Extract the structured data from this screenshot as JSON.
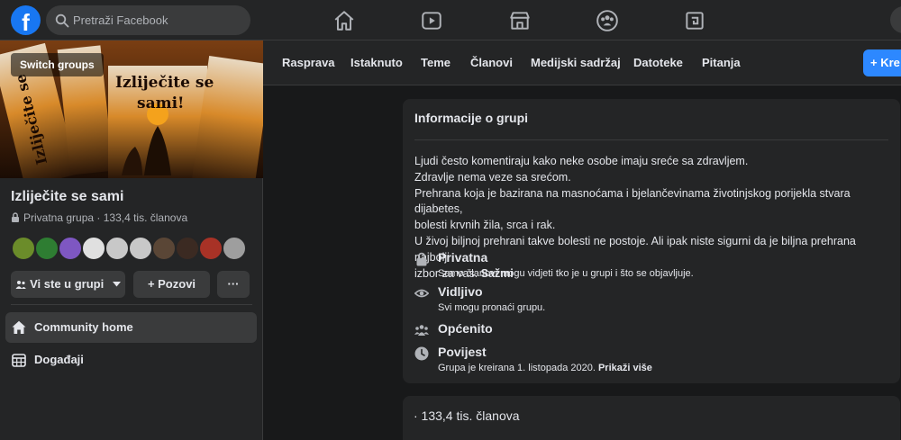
{
  "topbar": {
    "logo_letter": "f",
    "search_placeholder": "Pretraži Facebook",
    "nav_icons": [
      "home-icon",
      "watch-icon",
      "marketplace-icon",
      "groups-icon",
      "gaming-icon"
    ]
  },
  "sidebar": {
    "cover": {
      "switch_groups_label": "Switch groups",
      "poster_title_line1": "Izliječite se",
      "poster_title_line2": "sami!"
    },
    "group_name": "Izliječite se sami",
    "group_privacy": "Privatna grupa",
    "group_members": "· 133,4 tis. članova",
    "in_group_label": "Vi ste u grupi",
    "invite_label": "+ Pozovi",
    "more_label": "···",
    "menu": [
      {
        "label": "Community home",
        "icon": "home-icon",
        "active": true
      },
      {
        "label": "Događaji",
        "icon": "calendar-icon",
        "active": false
      }
    ]
  },
  "tabs": [
    "Rasprava",
    "Istaknuto",
    "Teme",
    "Članovi",
    "Medijski sadržaj",
    "Datoteke",
    "Pitanja"
  ],
  "create_button_label": "+ Kre",
  "about": {
    "title": "Informacije o grupi",
    "description_lines": [
      "Ljudi često komentiraju kako neke osobe imaju sreće sa zdravljem.",
      "Zdravlje nema veze sa srećom.",
      "Prehrana koja je bazirana na masnoćama i bjelančevinama životinjskog porijekla stvara dijabetes,",
      "bolesti krvnih žila, srca i rak.",
      "U živoj biljnoj prehrani takve bolesti ne postoje. Ali ipak niste sigurni da je biljna prehrana najbolji",
      "izbor za vas."
    ],
    "see_less": "Sažmi",
    "rows": [
      {
        "icon": "lock-icon",
        "title": "Privatna",
        "subtitle": "Samo članovi mogu vidjeti tko je u grupi i što se objavljuje.",
        "link": ""
      },
      {
        "icon": "eye-icon",
        "title": "Vidljivo",
        "subtitle": "Svi mogu pronaći grupu.",
        "link": ""
      },
      {
        "icon": "people-icon",
        "title": "Općenito",
        "subtitle": "",
        "link": ""
      },
      {
        "icon": "clock-icon",
        "title": "Povijest",
        "subtitle": "Grupa je kreirana 1. listopada 2020.",
        "link": "Prikaži više"
      }
    ]
  },
  "members_card": {
    "text": "· 133,4 tis. članova"
  },
  "colors": {
    "background": "#18191a",
    "surface": "#242526",
    "accent": "#1877f2",
    "text": "#e4e6eb",
    "secondary_text": "#b0b3b8"
  }
}
